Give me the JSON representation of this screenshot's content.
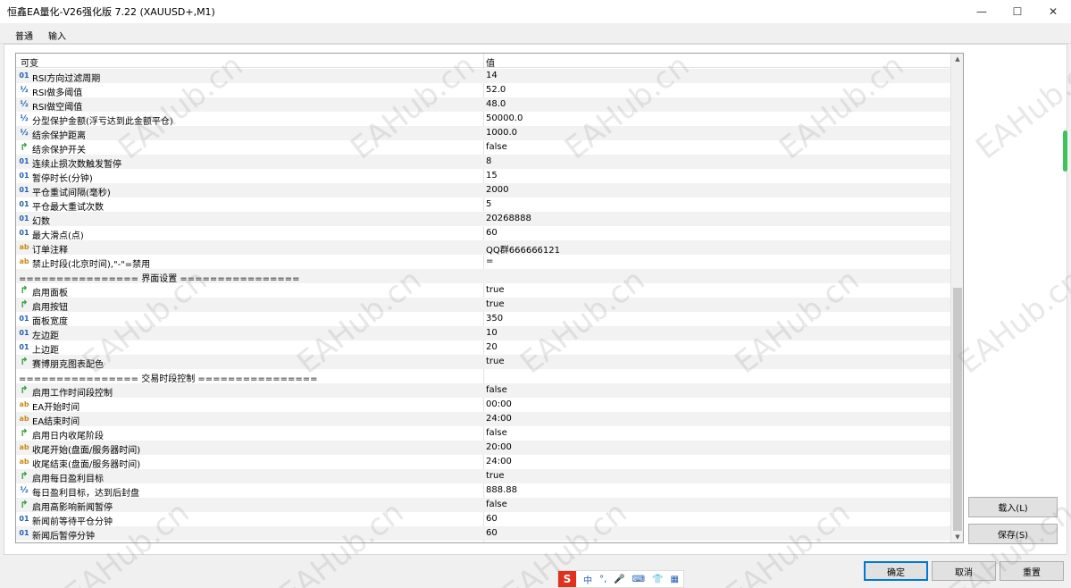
{
  "window": {
    "title": "恒鑫EA量化-V26强化版 7.22 (XAUUSD+,M1)",
    "minimize": "—",
    "maximize": "☐",
    "close": "✕"
  },
  "tabs": [
    {
      "label": "普通",
      "active": false
    },
    {
      "label": "输入",
      "active": true
    }
  ],
  "grid": {
    "col_name": "可变",
    "col_value": "值",
    "rows": [
      {
        "icon": "int",
        "name": "RSI方向过滤周期",
        "value": "14"
      },
      {
        "icon": "dbl",
        "name": "RSI做多阈值",
        "value": "52.0"
      },
      {
        "icon": "dbl",
        "name": "RSI做空阈值",
        "value": "48.0"
      },
      {
        "icon": "dbl",
        "name": "分型保护金额(浮亏达到此金额平仓)",
        "value": "50000.0"
      },
      {
        "icon": "dbl",
        "name": "结余保护距离",
        "value": "1000.0"
      },
      {
        "icon": "bool",
        "name": "结余保护开关",
        "value": "false"
      },
      {
        "icon": "int",
        "name": "连续止损次数触发暂停",
        "value": "8"
      },
      {
        "icon": "int",
        "name": "暂停时长(分钟)",
        "value": "15"
      },
      {
        "icon": "int",
        "name": "平仓重试间隔(毫秒)",
        "value": "2000"
      },
      {
        "icon": "int",
        "name": "平仓最大重试次数",
        "value": "5"
      },
      {
        "icon": "int",
        "name": "幻数",
        "value": "20268888"
      },
      {
        "icon": "int",
        "name": "最大滑点(点)",
        "value": "60"
      },
      {
        "icon": "str",
        "name": "订单注释",
        "value": "QQ群666666121"
      },
      {
        "icon": "str",
        "name": "禁止时段(北京时间),\"-\"=禁用",
        "value": "="
      },
      {
        "icon": "none",
        "name": "================ 界面设置 ================",
        "value": ""
      },
      {
        "icon": "bool",
        "name": "启用面板",
        "value": "true"
      },
      {
        "icon": "bool",
        "name": "启用按钮",
        "value": "true"
      },
      {
        "icon": "int",
        "name": "面板宽度",
        "value": "350"
      },
      {
        "icon": "int",
        "name": "左边距",
        "value": "10"
      },
      {
        "icon": "int",
        "name": "上边距",
        "value": "20"
      },
      {
        "icon": "bool",
        "name": "赛博朋克图表配色",
        "value": "true"
      },
      {
        "icon": "none",
        "name": "================ 交易时段控制 ================",
        "value": ""
      },
      {
        "icon": "bool",
        "name": "启用工作时间段控制",
        "value": "false"
      },
      {
        "icon": "str",
        "name": "EA开始时间",
        "value": "00:00"
      },
      {
        "icon": "str",
        "name": "EA结束时间",
        "value": "24:00"
      },
      {
        "icon": "bool",
        "name": "启用日内收尾阶段",
        "value": "false"
      },
      {
        "icon": "str",
        "name": "收尾开始(盘面/服务器时间)",
        "value": "20:00"
      },
      {
        "icon": "str",
        "name": "收尾结束(盘面/服务器时间)",
        "value": "24:00"
      },
      {
        "icon": "bool",
        "name": "启用每日盈利目标",
        "value": "true"
      },
      {
        "icon": "dbl",
        "name": "每日盈利目标，达到后封盘",
        "value": "888.88"
      },
      {
        "icon": "bool",
        "name": "启用高影响新闻暂停",
        "value": "false"
      },
      {
        "icon": "int",
        "name": "新闻前等待平仓分钟",
        "value": "60"
      },
      {
        "icon": "int",
        "name": "新闻后暂停分钟",
        "value": "60"
      }
    ]
  },
  "icons": {
    "int": "01",
    "dbl": "½",
    "bool": "↱",
    "str": "ab"
  },
  "buttons": {
    "load": "载入(L)",
    "save": "保存(S)",
    "ok": "确定",
    "cancel": "取消",
    "reset": "重置"
  },
  "ime": {
    "logo": "S",
    "mode": "中",
    "punct": "°,",
    "mic": "🎤",
    "kbd": "⌨",
    "skin": "👕",
    "apps": "▦"
  },
  "watermark": "EAHub.cn",
  "colors": {
    "accent": "#0078d7",
    "row_alt": "#f2f2f2",
    "bool_icon": "#2e9a3a",
    "int_icon": "#1f5fb8",
    "str_icon": "#c98a1a"
  }
}
